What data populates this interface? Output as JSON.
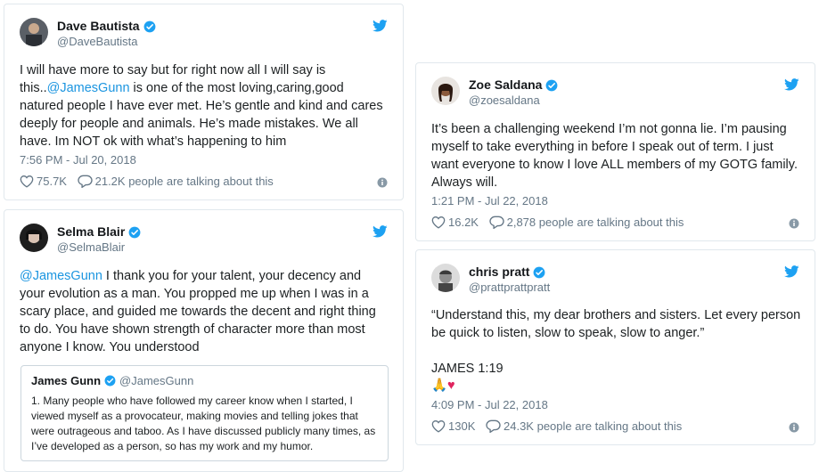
{
  "tweets": [
    {
      "name": "Dave Bautista",
      "handle": "@DaveBautista",
      "text_parts": [
        "I will have more to say but for right now all I will say is this..",
        "@JamesGunn",
        " is one of the most loving,caring,good natured people I have ever met. He’s gentle and kind and cares deeply for people and animals. He’s made mistakes. We all have. Im NOT ok with what’s happening to him"
      ],
      "time": "7:56 PM - Jul 20, 2018",
      "likes": "75.7K",
      "talking": "21.2K people are talking about this"
    },
    {
      "name": "Selma Blair",
      "handle": "@SelmaBlair",
      "text_parts": [
        "@JamesGunn",
        " I thank you for your talent, your decency and your evolution as a man. You propped me up when I was in a scary place, and guided me towards the decent and right thing to do. You have shown strength of character more than most anyone I know. You understood"
      ],
      "quote": {
        "name": "James Gunn",
        "handle": "@JamesGunn",
        "text": "1. Many people who have followed my career know when I started, I viewed myself as a provocateur, making movies and telling jokes that were outrageous and taboo. As I have discussed publicly many times, as I’ve developed as a person, so has my work and my humor."
      }
    },
    {
      "name": "Zoe Saldana",
      "handle": "@zoesaldana",
      "text": "It’s been a challenging weekend I’m not gonna lie. I’m pausing myself to take everything in before I speak out of term. I just want everyone to know I love ALL members of my GOTG family. Always will.",
      "time": "1:21 PM - Jul 22, 2018",
      "likes": "16.2K",
      "talking": "2,878 people are talking about this"
    },
    {
      "name": "chris pratt",
      "handle": "@prattprattpratt",
      "text": "“Understand this, my dear brothers and sisters. Let every person be quick to listen, slow to speak, slow to anger.”",
      "verse": "JAMES 1:19",
      "emoji": "🙏♥",
      "time": "4:09 PM - Jul 22, 2018",
      "likes": "130K",
      "talking": "24.3K people are talking about this"
    }
  ],
  "colors": {
    "twitter_blue": "#1da1f2",
    "link_blue": "#1b95e0",
    "secondary_text": "#657786",
    "border": "#e1e8ed"
  },
  "icons": [
    "twitter-bird-icon",
    "verified-badge-icon",
    "heart-icon",
    "reply-bubble-icon",
    "info-icon"
  ]
}
